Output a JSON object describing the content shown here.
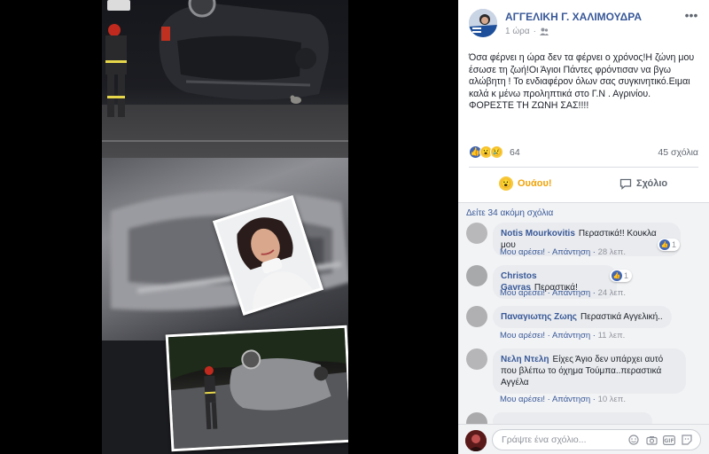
{
  "post": {
    "author": "ΑΓΓΕΛΙΚΗ Γ. ΧΑΛΙΜΟΥΔΡΑ",
    "time": "1 ώρα",
    "privacy_icon": "friends-icon",
    "text": "Όσα φέρνει η ώρα δεν τα φέρνει ο χρόνος!Η ζώνη μου έσωσε τη ζωή!Οι Άγιοι Πάντες φρόντισαν να βγω αλώβητη ! Το ενδιαφέρον όλων σας συγκινητικό.Ειμαι καλά κ μένω προληπτικά στο Γ.Ν . Αγρινίου. ΦΟΡΕΣΤΕ ΤΗ ΖΩΝΗ ΣΑΣ!!!!",
    "reaction_count": "64",
    "comment_count": "45 σχόλια",
    "reactions": [
      "like-icon",
      "wow-icon",
      "sad-icon"
    ]
  },
  "actions": {
    "react_label": "Ουάου!",
    "comment_label": "Σχόλιο"
  },
  "comments": {
    "more_label": "Δείτε 34 ακόμη σχόλια",
    "like_label": "Μου αρέσει!",
    "reply_label": "Απάντηση",
    "items": [
      {
        "author": "Notis Mourkovitis",
        "text": "Περαστικά!! Κουκλα μου",
        "time": "28 λεπ.",
        "likes": "1"
      },
      {
        "author": "Christos Gavras",
        "text": "Περαστικά!",
        "time": "24 λεπ.",
        "likes": "1"
      },
      {
        "author": "Παναγιωτης Ζωης",
        "text": "Περαστικά Αγγελική..",
        "time": "11 λεπ.",
        "likes": ""
      },
      {
        "author": "Νελη Ντελη",
        "text": "Είχες Άγιο δεν υπάρχει αυτό που βλέπω το όχημα Τούμπα..περαστικά Αγγέλα",
        "time": "10 λεπ.",
        "likes": ""
      }
    ]
  },
  "compose": {
    "placeholder": "Γράψτε ένα σχόλιο..."
  },
  "colors": {
    "link": "#385898",
    "react_active": "#f0a30a",
    "like_blue": "#4267b2"
  }
}
